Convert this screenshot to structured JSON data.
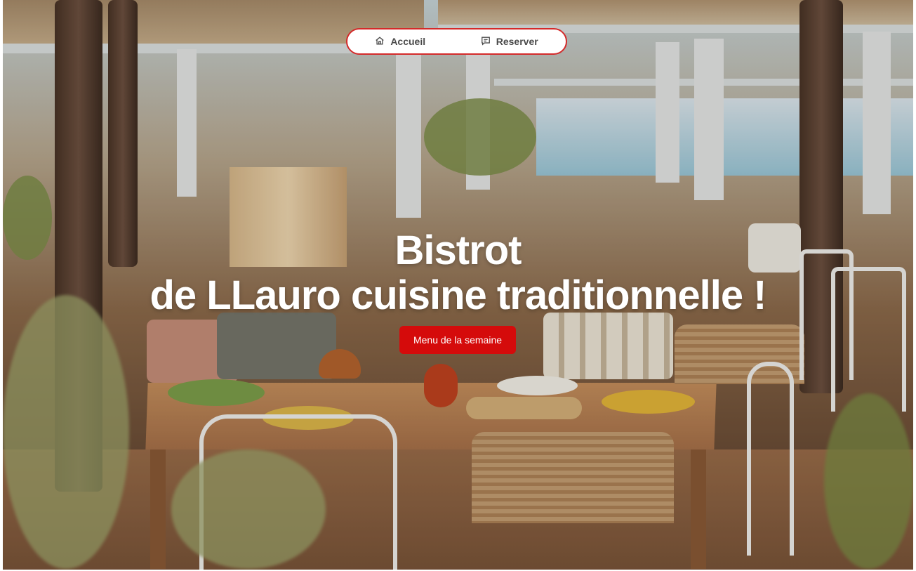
{
  "nav": {
    "items": [
      {
        "label": "Accueil",
        "icon": "home-icon"
      },
      {
        "label": "Reserver",
        "icon": "message-icon"
      }
    ],
    "border_color": "#d42a2a"
  },
  "hero": {
    "title_line1": "Bistrot",
    "title_line2": "de LLauro cuisine traditionnelle !",
    "cta_label": "Menu de la semaine",
    "cta_color": "#d50b0b",
    "background": "restaurant terrace photo"
  }
}
